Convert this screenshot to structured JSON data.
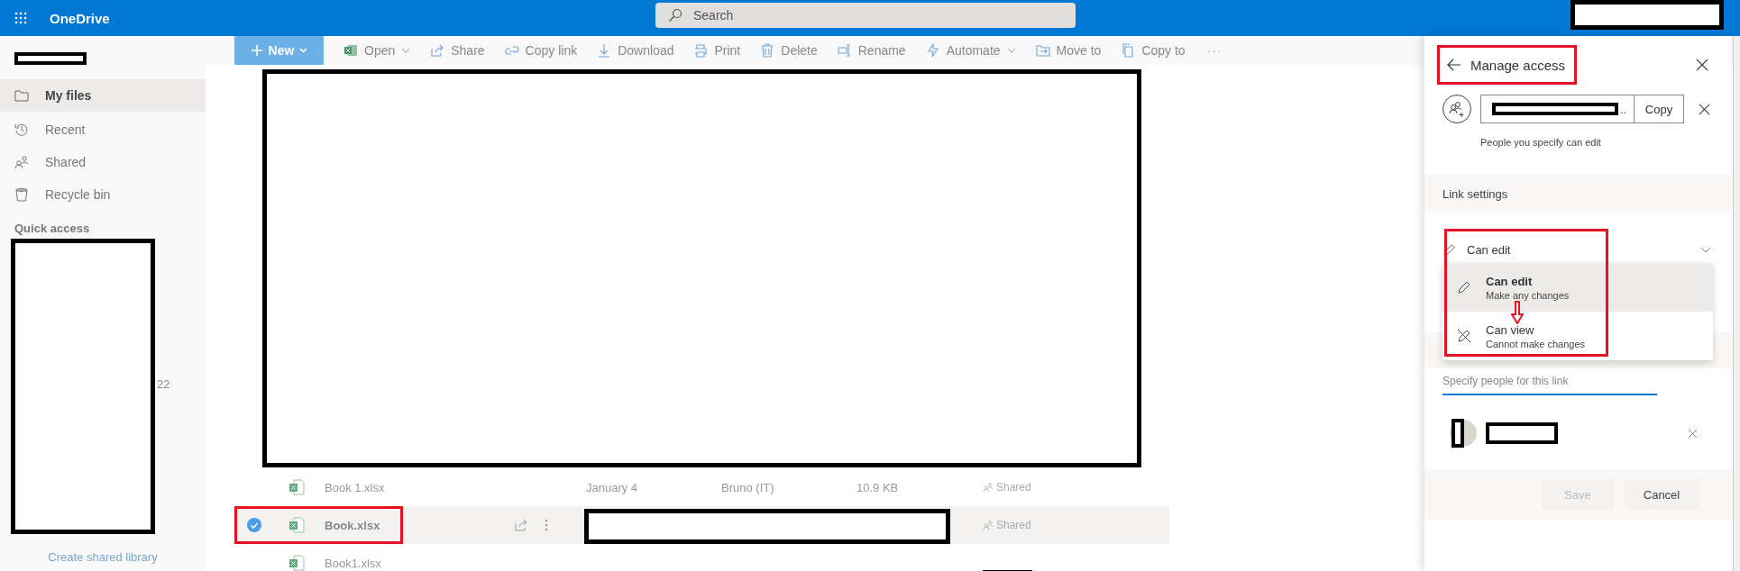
{
  "app_bar": {
    "app_name": "OneDrive",
    "search": {
      "placeholder": "Search"
    },
    "account_redacted": true
  },
  "sidebar": {
    "user_redacted": true,
    "items": [
      {
        "label": "My files",
        "selected": true
      },
      {
        "label": "Recent",
        "selected": false
      },
      {
        "label": "Shared",
        "selected": false
      },
      {
        "label": "Recycle bin",
        "selected": false
      }
    ],
    "quick_access": {
      "heading": "Quick access",
      "redacted": true,
      "visible_fragment": "22"
    },
    "create_link": "Create shared library"
  },
  "toolbar": [
    {
      "kind": "primary",
      "label": "New"
    },
    {
      "kind": "dropdown",
      "label": "Open"
    },
    {
      "kind": "plain",
      "label": "Share"
    },
    {
      "kind": "plain",
      "label": "Copy link"
    },
    {
      "kind": "plain",
      "label": "Download"
    },
    {
      "kind": "plain",
      "label": "Print"
    },
    {
      "kind": "plain",
      "label": "Delete"
    },
    {
      "kind": "plain",
      "label": "Rename"
    },
    {
      "kind": "dropdown",
      "label": "Automate"
    },
    {
      "kind": "plain",
      "label": "Move to"
    },
    {
      "kind": "plain",
      "label": "Copy to"
    },
    {
      "kind": "more",
      "label": "···"
    }
  ],
  "files": {
    "redacted_rows": true,
    "rows": [
      {
        "name": "Book 1.xlsx",
        "modified": "January 4",
        "modified_by": "Bruno (IT)",
        "size": "10.9 KB",
        "sharing": "Shared",
        "selected": false,
        "highlighted": false,
        "details_redacted": false
      },
      {
        "name": "Book.xlsx",
        "modified": "",
        "modified_by": "",
        "size": "",
        "sharing": "Shared",
        "selected": true,
        "highlighted": true,
        "details_redacted": true
      },
      {
        "name": "Book1.xlsx",
        "modified": "",
        "modified_by": "",
        "size": "",
        "sharing": "",
        "selected": false,
        "highlighted": false,
        "details_redacted": false,
        "sharing_redacted": true
      }
    ]
  },
  "panel": {
    "title": "Manage access",
    "title_highlighted": true,
    "link": {
      "value": "..",
      "redacted": true,
      "copy_button": "Copy"
    },
    "link_description": "People you specify can edit",
    "section_heading": "Link settings",
    "permission": {
      "value": "Can edit",
      "highlighted": true,
      "arrow": true,
      "options": [
        {
          "title": "Can edit",
          "subtitle": "Make any changes",
          "selected": true
        },
        {
          "title": "Can view",
          "subtitle": "Cannot make changes",
          "selected": false
        }
      ]
    },
    "people_field": {
      "placeholder": "Specify people for this link"
    },
    "people": [
      {
        "redacted": true
      }
    ],
    "buttons": [
      {
        "label": "Save",
        "disabled": true
      },
      {
        "label": "Cancel",
        "disabled": false
      }
    ]
  }
}
